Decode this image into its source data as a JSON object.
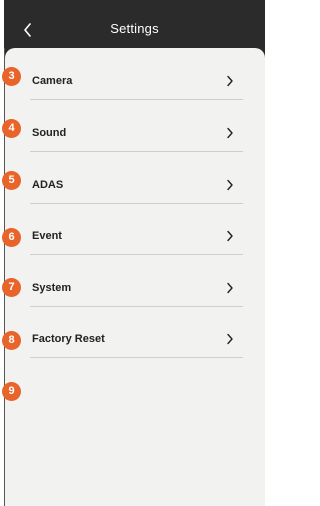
{
  "header": {
    "title": "Settings",
    "back_icon": "chevron-left-icon"
  },
  "menu": {
    "items": [
      {
        "label": "Camera",
        "badge": "3"
      },
      {
        "label": "Sound",
        "badge": "4"
      },
      {
        "label": "ADAS",
        "badge": "5"
      },
      {
        "label": "Event",
        "badge": "6"
      },
      {
        "label": "System",
        "badge": "7"
      },
      {
        "label": "Factory Reset",
        "badge": "8"
      }
    ],
    "extra_badge": "9"
  },
  "colors": {
    "header_bg": "#2b2b2b",
    "panel_bg": "#f2f2f1",
    "badge": "#e8642a"
  }
}
